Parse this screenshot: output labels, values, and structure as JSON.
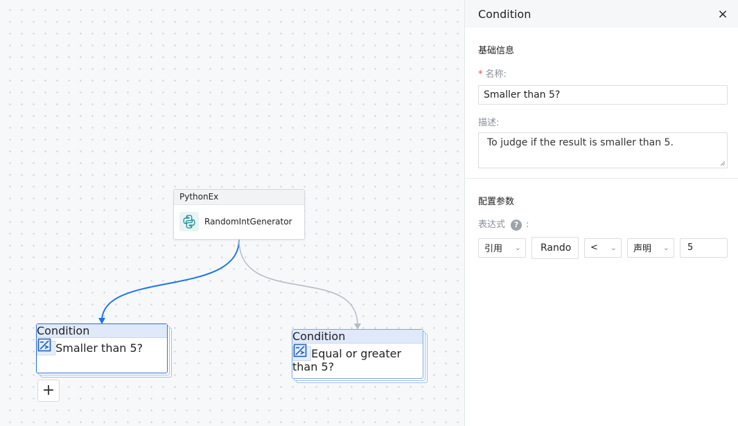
{
  "canvas": {
    "python_node": {
      "header": "PythonEx",
      "label": "RandomIntGenerator",
      "icon": "python-icon"
    },
    "condition_nodes": [
      {
        "header": "Condition",
        "label": "Smaller than 5?",
        "icon": "condition-icon",
        "selected": true
      },
      {
        "header": "Condition",
        "label": "Equal or greater than 5?",
        "icon": "condition-icon",
        "selected": false
      }
    ],
    "add_button": "+",
    "colors": {
      "edge_active": "#1a73e8",
      "edge_inactive": "#b8bcc4",
      "node_border": "#7aa6dc"
    }
  },
  "panel": {
    "title": "Condition",
    "close_icon": "×",
    "basic_info": {
      "section_title": "基础信息",
      "name_required": "*",
      "name_label": "名称:",
      "name_value": "Smaller than 5?",
      "desc_label": "描述:",
      "desc_value": "To judge if the result is smaller than 5."
    },
    "config": {
      "section_title": "配置参数",
      "expr_label": "表达式",
      "help": "?",
      "colon": ":",
      "left_type": "引用",
      "left_ref": "Rando",
      "operator": "<",
      "right_type": "声明",
      "right_value": "5"
    }
  }
}
